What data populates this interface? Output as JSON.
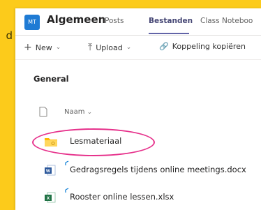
{
  "edge_text": "d",
  "header": {
    "avatar_initials": "MT",
    "title": "Algemeen",
    "tabs": [
      {
        "label": "Posts",
        "active": false
      },
      {
        "label": "Bestanden",
        "active": true
      },
      {
        "label": "Class Noteboo",
        "active": false
      }
    ]
  },
  "toolbar": {
    "new_label": "New",
    "upload_label": "Upload",
    "copy_link_label": "Koppeling kopiëren"
  },
  "section_title": "General",
  "columns": {
    "name_label": "Naam"
  },
  "files": [
    {
      "name": "Lesmateriaal",
      "type": "folder",
      "new": false
    },
    {
      "name": "Gedragsregels tijdens online meetings.docx",
      "type": "word",
      "new": true
    },
    {
      "name": "Rooster online lessen.xlsx",
      "type": "excel",
      "new": true
    }
  ],
  "colors": {
    "background": "#FCCB1B",
    "highlight": "#E6318B",
    "accent": "#6264A7",
    "team_avatar": "#1F7BD4"
  }
}
